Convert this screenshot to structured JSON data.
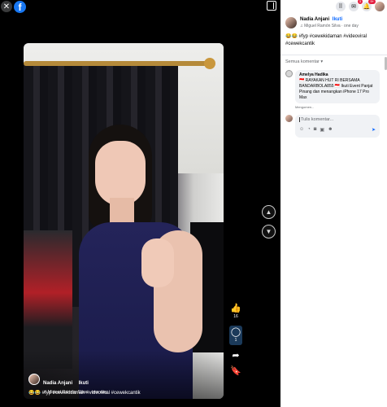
{
  "topbar": {
    "close_icon": "close-icon",
    "logo_letter": "f"
  },
  "video": {
    "author_name": "Nadia Anjani",
    "follow_label": "Ikuti",
    "sub": "♫ Miguel Ramón Silva · one day",
    "caption": "😂😂 #fyp #cewekidaman #videoviral #cewekcantik"
  },
  "rail": {
    "like_count": "16",
    "comment_count": "1"
  },
  "panel": {
    "author_name": "Nadia Anjani",
    "follow_label": "Ikuti",
    "sub": "♫ Miguel Ramón Silva · one day",
    "caption_line1": "😂😂 #fyp #cewekidaman #videoviral",
    "caption_line2": "#cewekcantik",
    "sort_label": "Semua komentar ▾",
    "comment": {
      "name": "Amelya Hadika",
      "text": "🇮🇩 RAYAKAN HUT RI BERSAMA BANDARBOLA855 🇮🇩 Ikuti Event Panjat Pinang dan menangkan iPhone 17 Pro Max",
      "time": "Mengomen..."
    },
    "input_placeholder": "Tulis komentar...",
    "notif_badge": "9+",
    "messenger_badge": "3"
  },
  "colors": {
    "accent": "#0866ff",
    "fb_blue": "#1877f2",
    "badge_red": "#e41e3f"
  }
}
